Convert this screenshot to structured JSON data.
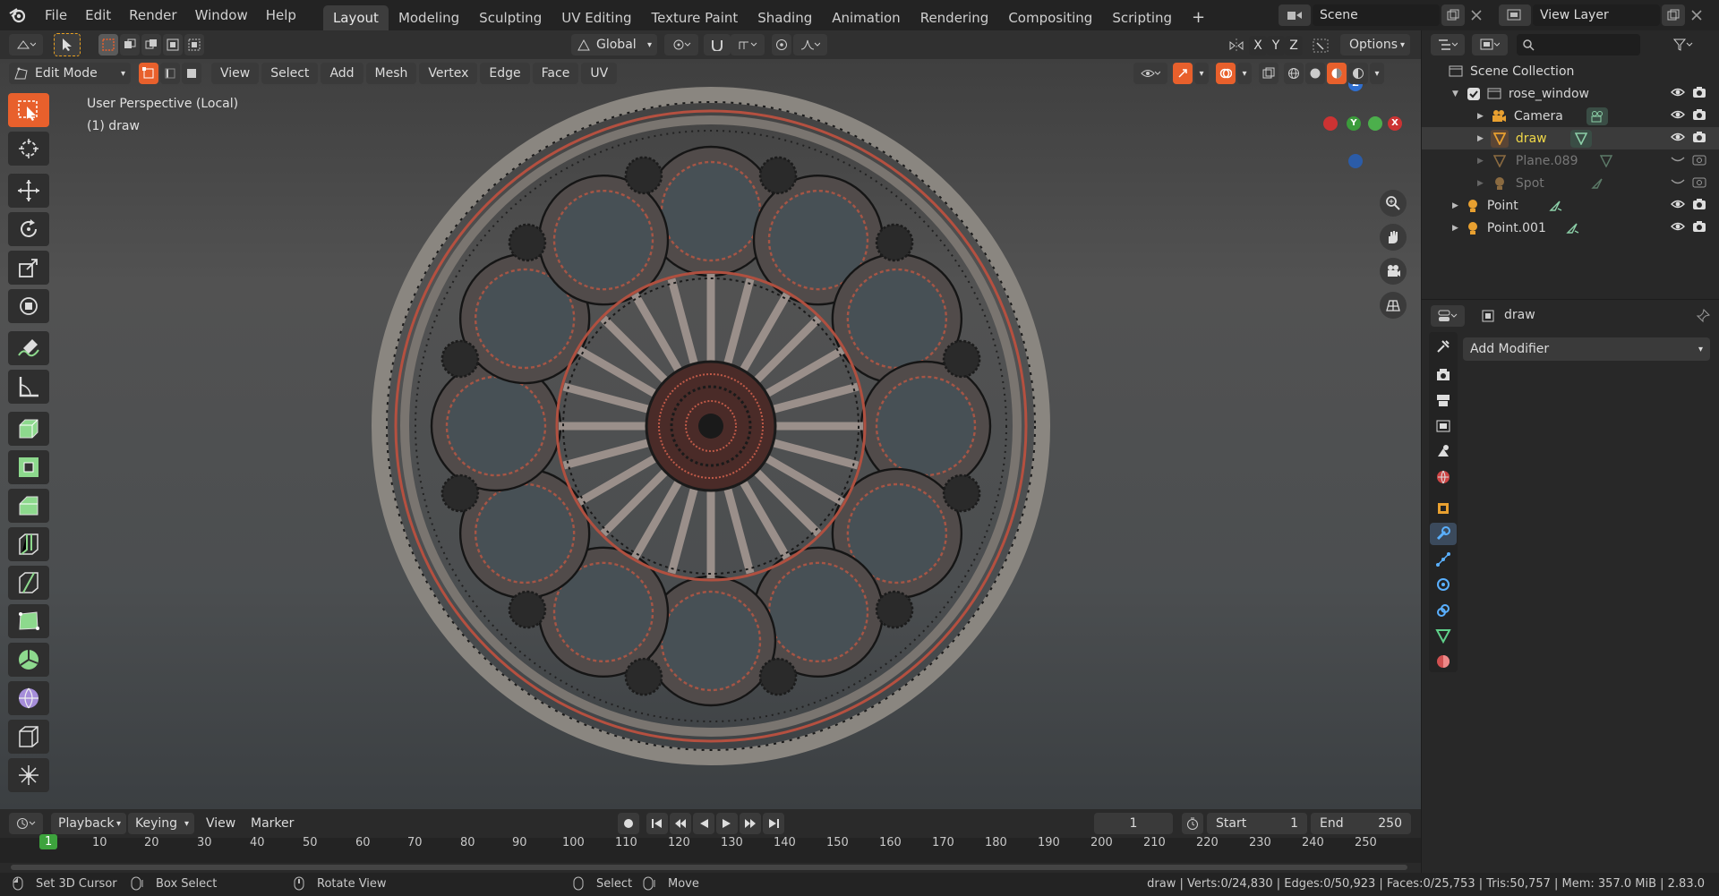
{
  "menubar": {
    "items": [
      "File",
      "Edit",
      "Render",
      "Window",
      "Help"
    ],
    "workspaces": [
      "Layout",
      "Modeling",
      "Sculpting",
      "UV Editing",
      "Texture Paint",
      "Shading",
      "Animation",
      "Rendering",
      "Compositing",
      "Scripting"
    ],
    "active_workspace": "Layout",
    "add_workspace": "+",
    "scene_label": "Scene",
    "view_layer_label": "View Layer"
  },
  "header": {
    "orientation": "Global",
    "options_label": "Options",
    "axis_x": "X",
    "axis_y": "Y",
    "axis_z": "Z"
  },
  "viewport_header": {
    "mode": "Edit Mode",
    "menus": [
      "View",
      "Select",
      "Add",
      "Mesh",
      "Vertex",
      "Edge",
      "Face",
      "UV"
    ]
  },
  "viewport": {
    "perspective_text": "User Perspective (Local)",
    "object_text": "(1) draw",
    "gizmo": {
      "z": "Z",
      "y": "Y",
      "x": "X"
    }
  },
  "outliner": {
    "search_placeholder": "",
    "scene_collection": "Scene Collection",
    "items": [
      {
        "label": "rose_window",
        "icon": "collection-icon",
        "visible": true,
        "dim": false,
        "selected": false
      },
      {
        "label": "Camera",
        "icon": "camera-icon",
        "visible": true,
        "dim": false,
        "selected": false
      },
      {
        "label": "draw",
        "icon": "mesh-icon",
        "visible": true,
        "dim": false,
        "selected": true
      },
      {
        "label": "Plane.089",
        "icon": "mesh-icon",
        "visible": false,
        "dim": true,
        "selected": false
      },
      {
        "label": "Spot",
        "icon": "light-icon",
        "visible": false,
        "dim": true,
        "selected": false
      },
      {
        "label": "Point",
        "icon": "light-icon",
        "visible": true,
        "dim": false,
        "selected": false
      },
      {
        "label": "Point.001",
        "icon": "light-icon",
        "visible": true,
        "dim": false,
        "selected": false
      }
    ]
  },
  "properties": {
    "object_name": "draw",
    "add_modifier": "Add Modifier"
  },
  "timeline": {
    "menus": [
      "Playback",
      "Keying",
      "View",
      "Marker"
    ],
    "current_frame": "1",
    "start_label": "Start",
    "start_value": "1",
    "end_label": "End",
    "end_value": "250",
    "ticks": [
      "1",
      "10",
      "20",
      "30",
      "40",
      "50",
      "60",
      "70",
      "80",
      "90",
      "100",
      "110",
      "120",
      "130",
      "140",
      "150",
      "160",
      "170",
      "180",
      "190",
      "200",
      "210",
      "220",
      "230",
      "240",
      "250"
    ]
  },
  "statusbar": {
    "hints": [
      "Set 3D Cursor",
      "Box Select",
      "Rotate View",
      "Select",
      "Move"
    ],
    "stats": "draw | Verts:0/24,830 | Edges:0/50,923 | Faces:0/25,753 | Tris:50,757 | Mem: 357.0 MiB | 2.83.0"
  },
  "colors": {
    "accent": "#e8602c",
    "selected_blue": "#4d5a6e",
    "green_frame": "#3da33d"
  }
}
